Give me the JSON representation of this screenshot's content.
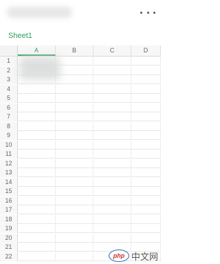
{
  "header": {
    "more_label": "···"
  },
  "sheet": {
    "tab_label": "Sheet1"
  },
  "grid": {
    "columns": [
      "A",
      "B",
      "C",
      "D"
    ],
    "rows": [
      "1",
      "2",
      "3",
      "4",
      "5",
      "6",
      "7",
      "8",
      "9",
      "10",
      "11",
      "12",
      "13",
      "14",
      "15",
      "16",
      "17",
      "18",
      "19",
      "20",
      "21",
      "22"
    ]
  },
  "watermark": {
    "logo_text": "php",
    "site_text": "中文网"
  },
  "colors": {
    "accent": "#2e9e5e"
  }
}
